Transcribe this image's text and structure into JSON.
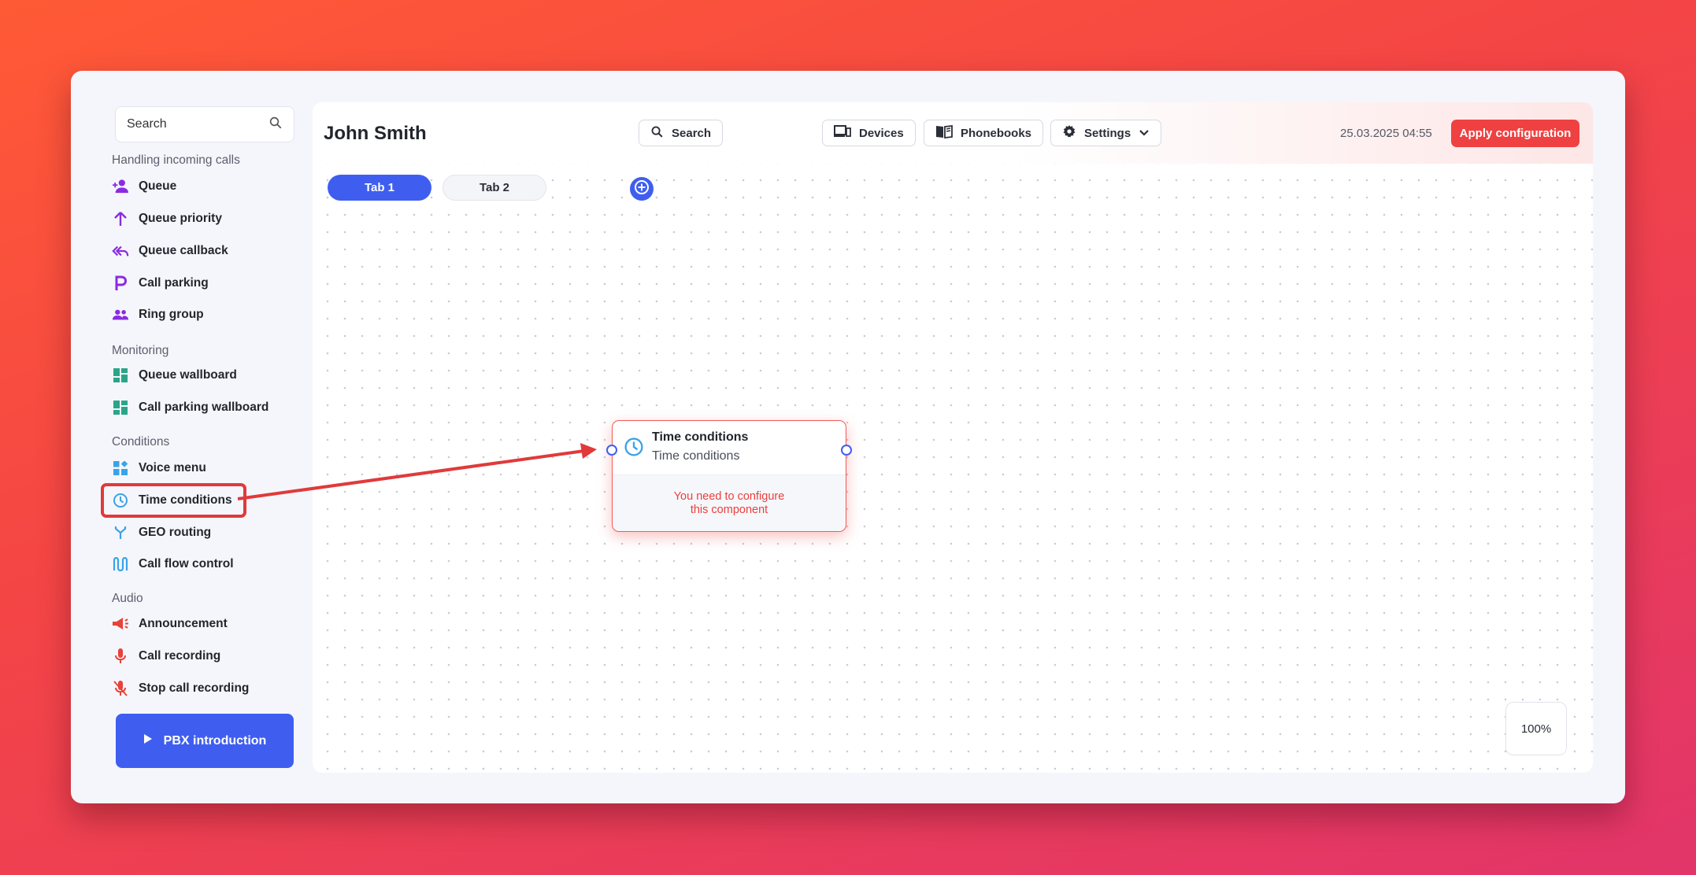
{
  "sidebar": {
    "search_placeholder": "Search",
    "sections": [
      {
        "title": "Handling incoming calls"
      },
      {
        "title": "Monitoring"
      },
      {
        "title": "Conditions"
      },
      {
        "title": "Audio"
      }
    ],
    "items": [
      {
        "label": "Queue",
        "icon": "person-add-icon"
      },
      {
        "label": "Queue priority",
        "icon": "arrow-up-icon"
      },
      {
        "label": "Queue callback",
        "icon": "reply-all-icon"
      },
      {
        "label": "Call parking",
        "icon": "parking-icon"
      },
      {
        "label": "Ring group",
        "icon": "group-icon"
      },
      {
        "label": "Queue wallboard",
        "icon": "dashboard-icon"
      },
      {
        "label": "Call parking wallboard",
        "icon": "dashboard-icon"
      },
      {
        "label": "Voice menu",
        "icon": "widgets-icon"
      },
      {
        "label": "Time conditions",
        "icon": "clock-icon"
      },
      {
        "label": "GEO routing",
        "icon": "fork-icon"
      },
      {
        "label": "Call flow control",
        "icon": "flow-icon"
      },
      {
        "label": "Announcement",
        "icon": "megaphone-icon"
      },
      {
        "label": "Call recording",
        "icon": "microphone-icon"
      },
      {
        "label": "Stop call recording",
        "icon": "microphone-off-icon"
      }
    ],
    "pbx_button": "PBX introduction"
  },
  "header": {
    "title": "John Smith",
    "search_label": "Search",
    "devices_label": "Devices",
    "phonebooks_label": "Phonebooks",
    "settings_label": "Settings",
    "datetime": "25.03.2025 04:55",
    "apply_label": "Apply configuration"
  },
  "tabs": [
    {
      "label": "Tab 1",
      "active": true
    },
    {
      "label": "Tab 2",
      "active": false
    }
  ],
  "node": {
    "title": "Time conditions",
    "subtitle": "Time conditions",
    "warning_line1": "You need to configure",
    "warning_line2": "this component"
  },
  "zoom": "100%",
  "colors": {
    "accent": "#3f5ef0",
    "danger": "#ef4141",
    "purple": "#8a2be2",
    "teal": "#2aa58a",
    "blue": "#3aa3e8",
    "red": "#e8423a"
  }
}
